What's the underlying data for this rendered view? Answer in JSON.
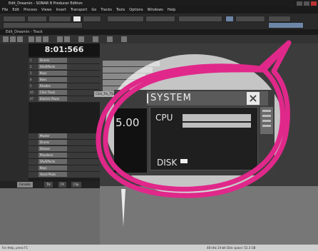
{
  "window": {
    "title": "Edit_Dreamin - SONAR 8 Producer Edition",
    "menu": [
      "File",
      "Edit",
      "Process",
      "Views",
      "Insert",
      "Transport",
      "Go",
      "Tracks",
      "Tools",
      "Options",
      "Windows",
      "Help"
    ]
  },
  "track_view": {
    "title": "Edit_Dreamin - Track",
    "time": "8:01:566",
    "tracks": [
      {
        "name": "Drums",
        "num": "1"
      },
      {
        "name": "Sfx/Effects",
        "num": "2"
      },
      {
        "name": "Keys",
        "num": "3"
      },
      {
        "name": "Bass",
        "num": "4"
      },
      {
        "name": "Rhodes",
        "num": "5"
      },
      {
        "name": "Click Track",
        "num": "45"
      },
      {
        "name": "Electric Piano",
        "num": "47"
      }
    ],
    "lower_tracks": [
      "Master",
      "Drums",
      "Deluxe",
      "Phushers",
      "Sfx/Effects",
      "Keys",
      "Vocal Pluto"
    ],
    "clip_labels": [
      "Click_Trk_T5c.Bus1-wav"
    ],
    "tabs": [
      "Console",
      "Trk",
      "FX",
      "Clip"
    ]
  },
  "system_panel": {
    "title": "SYSTEM",
    "cpu_label": "CPU",
    "disk_label": "DISK",
    "readout": "5.00",
    "cpu_load": 0.8,
    "disk_load": 0.05,
    "close_icon": "close-icon"
  },
  "statusbar": {
    "left": "For Help, press F1",
    "mid": "48 kHz  24-bit  Disk space: 52.3 GB"
  },
  "colors": {
    "magenta": "#e0288a",
    "panel_bg": "#3d3d3d",
    "header_bg": "#5a5a5a"
  }
}
